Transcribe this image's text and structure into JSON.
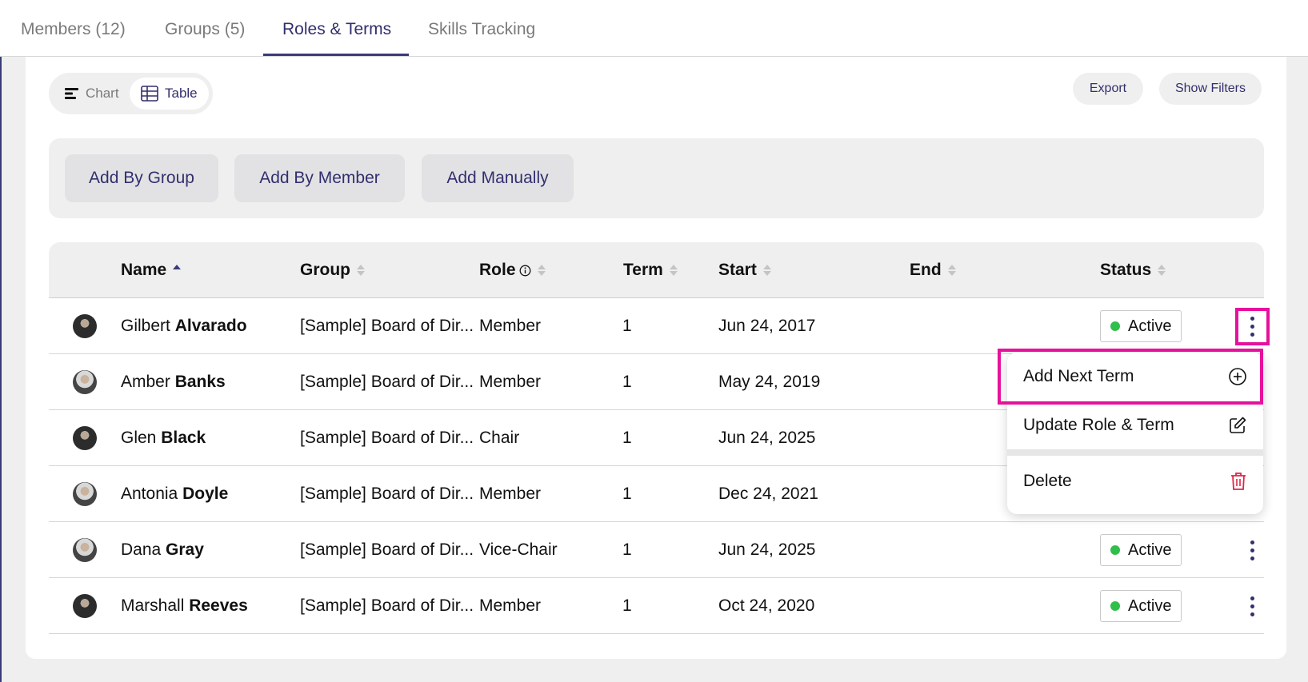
{
  "tabs": [
    {
      "label": "Members (12)"
    },
    {
      "label": "Groups (5)"
    },
    {
      "label": "Roles & Terms"
    },
    {
      "label": "Skills Tracking"
    }
  ],
  "view_toggle": {
    "chart": "Chart",
    "table": "Table",
    "selected": "Table"
  },
  "toolbar": {
    "export": "Export",
    "show_filters": "Show Filters"
  },
  "add_actions": {
    "by_group": "Add By Group",
    "by_member": "Add By Member",
    "manually": "Add Manually"
  },
  "table": {
    "columns": {
      "name": "Name",
      "group": "Group",
      "role": "Role",
      "term": "Term",
      "start": "Start",
      "end": "End",
      "status": "Status"
    },
    "rows": [
      {
        "first": "Gilbert",
        "last": "Alvarado",
        "group": "[Sample] Board of Dir...",
        "role": "Member",
        "term": "1",
        "start": "Jun 24, 2017",
        "end": "",
        "status": "Active"
      },
      {
        "first": "Amber",
        "last": "Banks",
        "group": "[Sample] Board of Dir...",
        "role": "Member",
        "term": "1",
        "start": "May 24, 2019",
        "end": "",
        "status": ""
      },
      {
        "first": "Glen",
        "last": "Black",
        "group": "[Sample] Board of Dir...",
        "role": "Chair",
        "term": "1",
        "start": "Jun 24, 2025",
        "end": "",
        "status": ""
      },
      {
        "first": "Antonia",
        "last": "Doyle",
        "group": "[Sample] Board of Dir...",
        "role": "Member",
        "term": "1",
        "start": "Dec 24, 2021",
        "end": "",
        "status": ""
      },
      {
        "first": "Dana",
        "last": "Gray",
        "group": "[Sample] Board of Dir...",
        "role": "Vice-Chair",
        "term": "1",
        "start": "Jun 24, 2025",
        "end": "",
        "status": "Active"
      },
      {
        "first": "Marshall",
        "last": "Reeves",
        "group": "[Sample] Board of Dir...",
        "role": "Member",
        "term": "1",
        "start": "Oct 24, 2020",
        "end": "",
        "status": "Active"
      }
    ]
  },
  "row_menu": {
    "add_next_term": "Add Next Term",
    "update_role_term": "Update Role & Term",
    "delete": "Delete"
  },
  "colors": {
    "accent": "#322f6e",
    "highlight": "#e6119c",
    "active_dot": "#2fbf4a",
    "delete": "#e0264a"
  }
}
